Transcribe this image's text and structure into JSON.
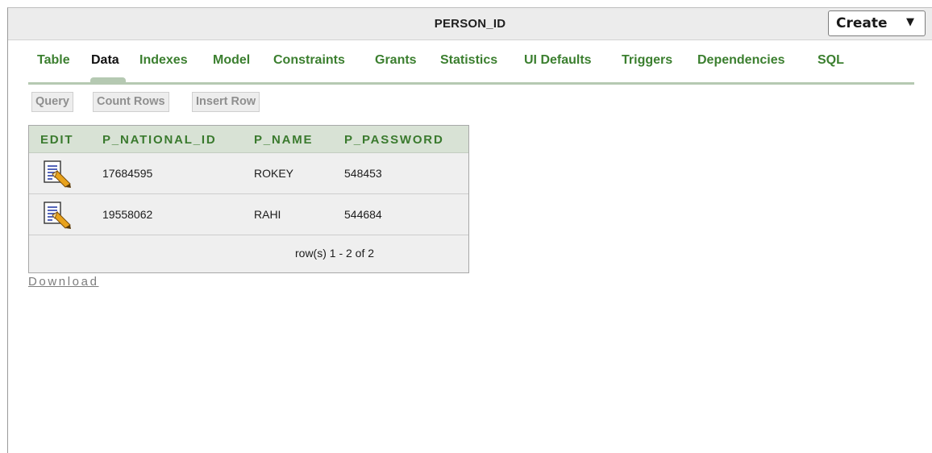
{
  "header": {
    "title": "PERSON_ID",
    "create_label": "Create",
    "create_arrow": "▼"
  },
  "tabs": [
    {
      "label": "Table",
      "active": false
    },
    {
      "label": "Data",
      "active": true
    },
    {
      "label": "Indexes",
      "active": false
    },
    {
      "label": "Model",
      "active": false
    },
    {
      "label": "Constraints",
      "active": false
    },
    {
      "label": "Grants",
      "active": false
    },
    {
      "label": "Statistics",
      "active": false
    },
    {
      "label": "UI Defaults",
      "active": false
    },
    {
      "label": "Triggers",
      "active": false
    },
    {
      "label": "Dependencies",
      "active": false
    },
    {
      "label": "SQL",
      "active": false
    }
  ],
  "toolbar": {
    "query_label": "Query",
    "count_rows_label": "Count Rows",
    "insert_row_label": "Insert Row"
  },
  "grid": {
    "columns": [
      "EDIT",
      "P_NATIONAL_ID",
      "P_NAME",
      "P_PASSWORD"
    ],
    "rows": [
      {
        "p_national_id": "17684595",
        "p_name": "ROKEY",
        "p_password": "548453",
        "edit_icon": "edit-record-icon"
      },
      {
        "p_national_id": "19558062",
        "p_name": "RAHI",
        "p_password": "544684",
        "edit_icon": "edit-record-icon"
      }
    ],
    "pagination": "row(s) 1 - 2 of 2"
  },
  "download_label": "Download",
  "colors": {
    "tab_green": "#3b7f2f",
    "header_bg": "#d8e2d5",
    "row_bg": "#efefef"
  }
}
